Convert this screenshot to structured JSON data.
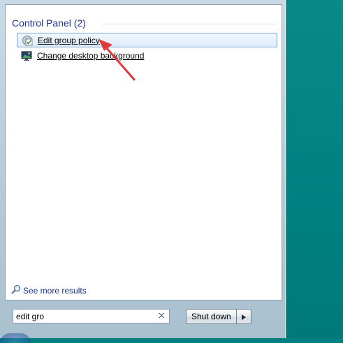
{
  "results": {
    "group_title": "Control Panel (2)",
    "items": [
      {
        "label": "Edit group policy",
        "icon": "group-policy-icon",
        "selected": true
      },
      {
        "label": "Change desktop background",
        "icon": "desktop-background-icon",
        "selected": false
      }
    ],
    "see_more_label": "See more results"
  },
  "search": {
    "value": "edit gro",
    "clear_icon": "×"
  },
  "power": {
    "shutdown_label": "Shut down",
    "arrow_icon": "right-triangle-icon"
  },
  "colors": {
    "desktop": "#008080",
    "annotation_arrow": "#e03a3a",
    "selection_border": "#7da2ce",
    "header_text": "#1e3287"
  }
}
